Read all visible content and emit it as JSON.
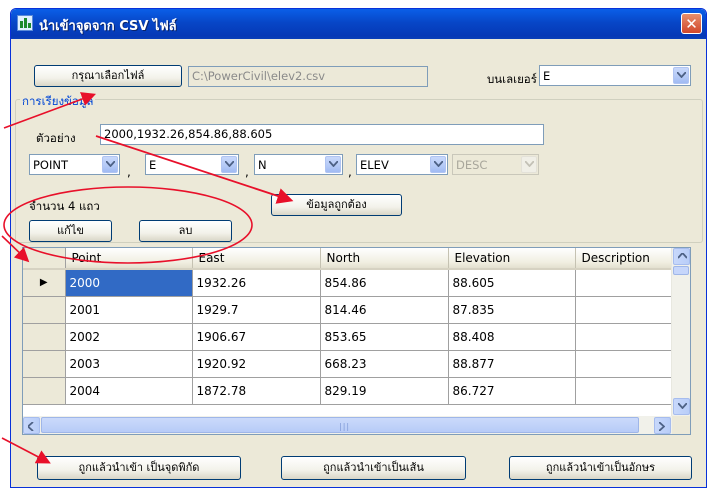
{
  "window": {
    "title": "นำเข้าจุดจาก CSV ไฟล์",
    "close_label": "✕"
  },
  "file": {
    "select_button": "กรุณาเลือกไฟล์",
    "path": "C:\\PowerCivil\\elev2.csv",
    "layer_label": "บนเลเยอร์",
    "layer_value": "E"
  },
  "arrange": {
    "group_label": "การเรียงข้อมูล",
    "sample_label": "ตัวอย่าง",
    "sample_value": "2000,1932.26,854.86,88.605",
    "fields": [
      "POINT",
      "E",
      "N",
      "ELEV",
      "DESC"
    ],
    "separator": ",",
    "confirm_button": "ข้อมูลถูกต้อง",
    "count_text": "จำนวน 4 แถว",
    "edit_button": "แก้ไข",
    "delete_button": "ลบ"
  },
  "grid": {
    "columns": [
      "Point",
      "East",
      "North",
      "Elevation",
      "Description"
    ],
    "rows": [
      [
        "2000",
        "1932.26",
        "854.86",
        "88.605",
        ""
      ],
      [
        "2001",
        "1929.7",
        "814.46",
        "87.835",
        ""
      ],
      [
        "2002",
        "1906.67",
        "853.65",
        "88.408",
        ""
      ],
      [
        "2003",
        "1920.92",
        "668.23",
        "88.877",
        ""
      ],
      [
        "2004",
        "1872.78",
        "829.19",
        "86.727",
        ""
      ]
    ],
    "current_row_marker": "▶",
    "scroll_grip": "|||"
  },
  "actions": {
    "import_coords": "ถูกแล้วนำเข้า เป็นจุดพิกัด",
    "import_lines": "ถูกแล้วนำเข้าเป็นเส้น",
    "import_text": "ถูกแล้วนำเข้าเป็นอักษร"
  },
  "colors": {
    "titlebar": "#0a5fe8",
    "annotation": "#e8102a",
    "selection": "#316ac5"
  }
}
